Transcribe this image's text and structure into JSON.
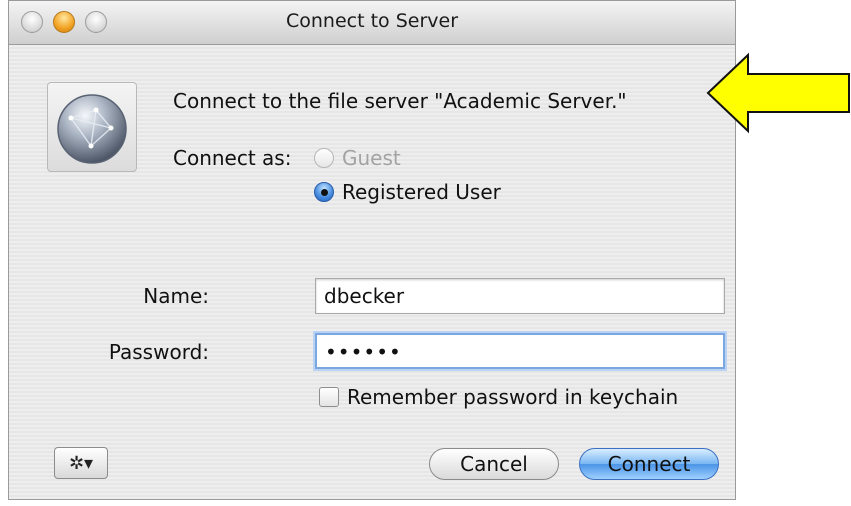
{
  "window": {
    "title": "Connect to Server"
  },
  "message": "Connect to the file server \"Academic Server.\"",
  "connect_as": {
    "label": "Connect as:",
    "options": [
      {
        "label": "Guest",
        "selected": false,
        "enabled": false
      },
      {
        "label": "Registered User",
        "selected": true,
        "enabled": true
      }
    ]
  },
  "form": {
    "name_label": "Name:",
    "name_value": "dbecker",
    "password_label": "Password:",
    "password_value": "••••••",
    "remember_label": "Remember password in keychain",
    "remember_checked": false
  },
  "buttons": {
    "cancel": "Cancel",
    "connect": "Connect",
    "gear_menu": "action-menu"
  },
  "colors": {
    "arrow_fill": "#ffff00",
    "default_button": "#79b6f2",
    "selected_radio": "#4a8fe0"
  },
  "icons": {
    "server": "network-server-icon",
    "gear": "gear-icon"
  }
}
